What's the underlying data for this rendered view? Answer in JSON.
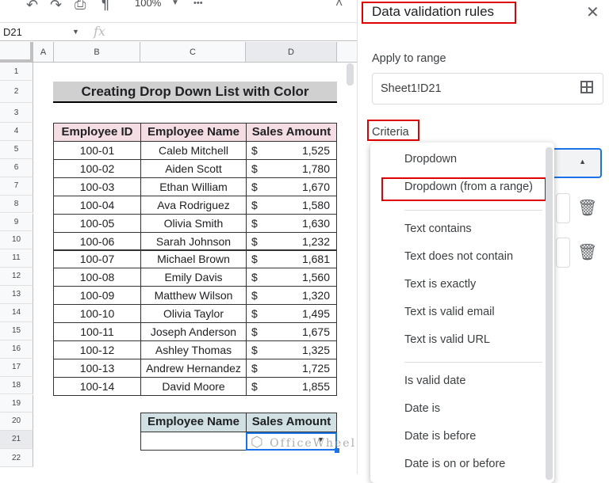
{
  "toolbar": {
    "zoom": "100%",
    "more": "•••"
  },
  "formula": {
    "name_box": "D21",
    "fx": "fx"
  },
  "columns": [
    "A",
    "B",
    "C",
    "D"
  ],
  "rows": [
    "1",
    "2",
    "3",
    "4",
    "5",
    "6",
    "7",
    "8",
    "9",
    "10",
    "11",
    "12",
    "13",
    "14",
    "15",
    "16",
    "17",
    "18",
    "19",
    "20",
    "21",
    "22"
  ],
  "sheet": {
    "title": "Creating Drop Down List with Color",
    "headers": [
      "Employee ID",
      "Employee Name",
      "Sales Amount"
    ],
    "currency": "$",
    "data": [
      [
        "100-01",
        "Caleb Mitchell",
        "1,525"
      ],
      [
        "100-02",
        "Aiden Scott",
        "1,780"
      ],
      [
        "100-03",
        "Ethan William",
        "1,670"
      ],
      [
        "100-04",
        "Ava Rodriguez",
        "1,580"
      ],
      [
        "100-05",
        "Olivia Smith",
        "1,630"
      ],
      [
        "100-06",
        "Sarah Johnson",
        "1,232"
      ],
      [
        "100-07",
        "Michael Brown",
        "1,681"
      ],
      [
        "100-08",
        "Emily Davis",
        "1,560"
      ],
      [
        "100-09",
        "Matthew Wilson",
        "1,320"
      ],
      [
        "100-10",
        "Olivia Taylor",
        "1,495"
      ],
      [
        "100-11",
        "Joseph Anderson",
        "1,675"
      ],
      [
        "100-12",
        "Ashley Thomas",
        "1,325"
      ],
      [
        "100-13",
        "Andrew Hernandez",
        "1,725"
      ],
      [
        "100-14",
        "David Moore",
        "1,855"
      ]
    ],
    "lookup_headers": [
      "Employee Name",
      "Sales Amount"
    ],
    "watermark": "OfficeWheel"
  },
  "panel": {
    "title": "Data validation rules",
    "apply_label": "Apply to range",
    "range": "Sheet1!D21",
    "criteria_label": "Criteria",
    "menu": [
      "Dropdown",
      "Dropdown (from a range)",
      "Text contains",
      "Text does not contain",
      "Text is exactly",
      "Text is valid email",
      "Text is valid URL",
      "Is valid date",
      "Date is",
      "Date is before",
      "Date is on or before"
    ]
  },
  "colors": {
    "header_pink": "#f4dde3",
    "lookup_blue": "#d0e0e3",
    "title_gray": "#d0d0d0",
    "accent": "#1a73e8",
    "highlight": "#e00000"
  }
}
